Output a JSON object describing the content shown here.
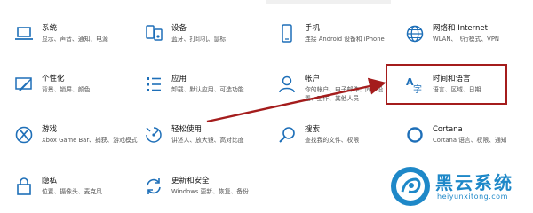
{
  "tiles": [
    {
      "id": "system",
      "title": "系统",
      "desc": "显示、声音、通知、电源"
    },
    {
      "id": "devices",
      "title": "设备",
      "desc": "蓝牙、打印机、鼠标"
    },
    {
      "id": "phone",
      "title": "手机",
      "desc": "连接 Android 设备和 iPhone"
    },
    {
      "id": "network",
      "title": "网络和 Internet",
      "desc": "WLAN、飞行模式、VPN"
    },
    {
      "id": "personalization",
      "title": "个性化",
      "desc": "背景、锁屏、颜色"
    },
    {
      "id": "apps",
      "title": "应用",
      "desc": "卸载、默认应用、可选功能"
    },
    {
      "id": "accounts",
      "title": "帐户",
      "desc": "你的帐户、电子邮件、同步设置、工作、其他人员"
    },
    {
      "id": "time",
      "title": "时间和语言",
      "desc": "语言、区域、日期"
    },
    {
      "id": "gaming",
      "title": "游戏",
      "desc": "Xbox Game Bar、捕获、游戏模式"
    },
    {
      "id": "ease",
      "title": "轻松使用",
      "desc": "讲述人、放大镜、高对比度"
    },
    {
      "id": "search",
      "title": "搜索",
      "desc": "查找我的文件、权限"
    },
    {
      "id": "cortana",
      "title": "Cortana",
      "desc": "Cortana 语言、权限、通知"
    },
    {
      "id": "privacy",
      "title": "隐私",
      "desc": "位置、摄像头、麦克风"
    },
    {
      "id": "update",
      "title": "更新和安全",
      "desc": "Windows 更新、恢复、备份"
    }
  ],
  "highlight_color": "#a41c1c",
  "icon_color": "#1e6fb8",
  "watermark": {
    "name": "黑云系统",
    "url": "heiyunxitong.com",
    "color": "#1e88c8"
  }
}
